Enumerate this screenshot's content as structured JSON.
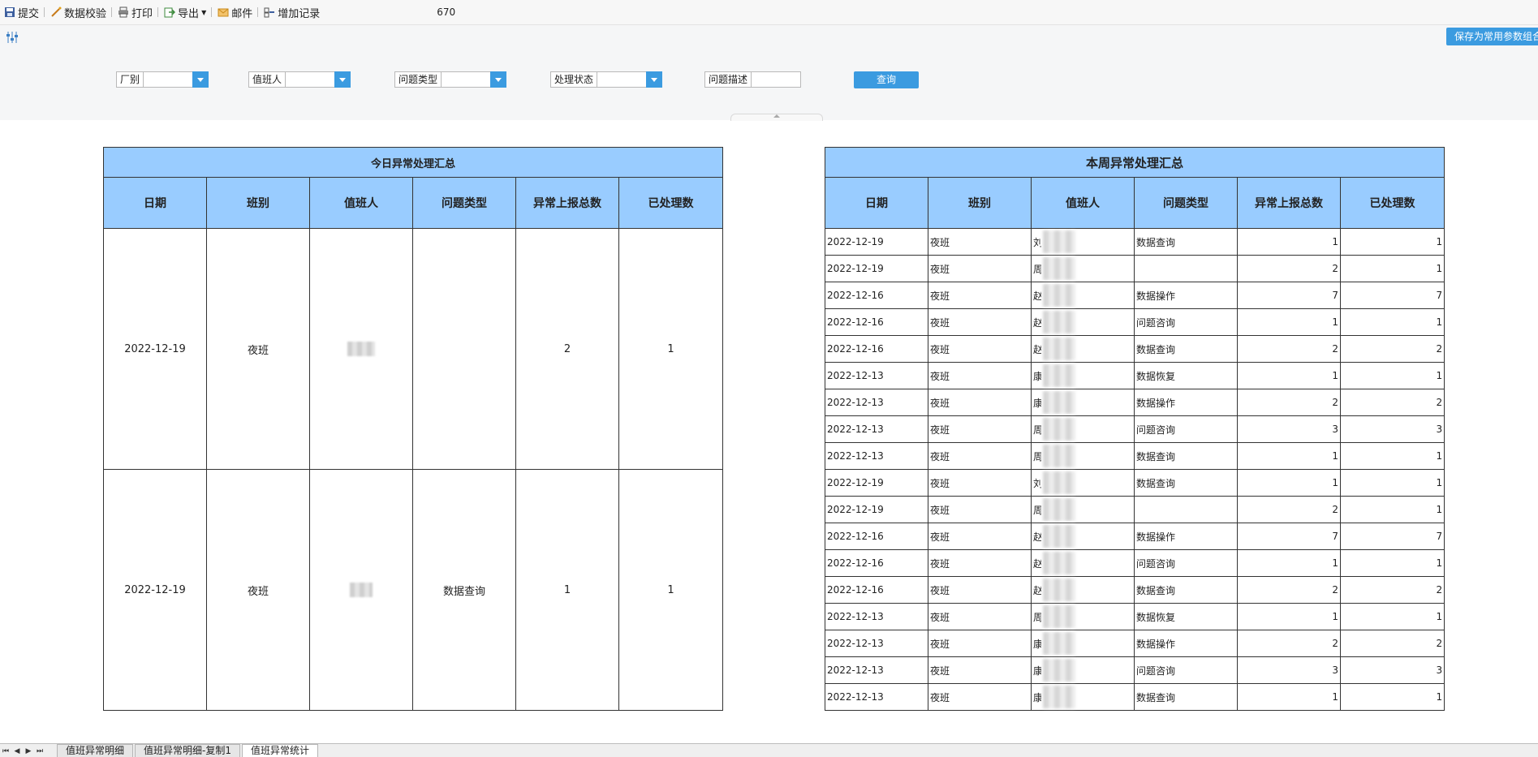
{
  "toolbar": {
    "items": [
      {
        "label": "提交",
        "icon": "save-icon"
      },
      {
        "label": "数据校验",
        "icon": "wand-icon"
      },
      {
        "label": "打印",
        "icon": "print-icon"
      },
      {
        "label": "导出",
        "icon": "export-icon"
      },
      {
        "label": "邮件",
        "icon": "mail-icon"
      },
      {
        "label": "增加记录",
        "icon": "add-record-icon"
      }
    ],
    "number": "670"
  },
  "params": {
    "save_button": "保存为常用参数组合",
    "filters": {
      "factory": "厂别",
      "duty_person": "值班人",
      "issue_type": "问题类型",
      "status": "处理状态",
      "description": "问题描述"
    },
    "query_button": "查询"
  },
  "today": {
    "title": "今日异常处理汇总",
    "headers": [
      "日期",
      "班别",
      "值班人",
      "问题类型",
      "异常上报总数",
      "已处理数"
    ],
    "rows": [
      {
        "date": "2022-12-19",
        "shift": "夜班",
        "type": "",
        "total": "2",
        "handled": "1"
      },
      {
        "date": "2022-12-19",
        "shift": "夜班",
        "type": "数据查询",
        "total": "1",
        "handled": "1"
      }
    ]
  },
  "week": {
    "title": "本周异常处理汇总",
    "headers": [
      "日期",
      "班别",
      "值班人",
      "问题类型",
      "异常上报总数",
      "已处理数"
    ],
    "rows": [
      {
        "date": "2022-12-19",
        "shift": "夜班",
        "person": "刘",
        "type": "数据查询",
        "total": "1",
        "handled": "1"
      },
      {
        "date": "2022-12-19",
        "shift": "夜班",
        "person": "周",
        "type": "",
        "total": "2",
        "handled": "1"
      },
      {
        "date": "2022-12-16",
        "shift": "夜班",
        "person": "赵",
        "type": "数据操作",
        "total": "7",
        "handled": "7"
      },
      {
        "date": "2022-12-16",
        "shift": "夜班",
        "person": "赵",
        "type": "问题咨询",
        "total": "1",
        "handled": "1"
      },
      {
        "date": "2022-12-16",
        "shift": "夜班",
        "person": "赵",
        "type": "数据查询",
        "total": "2",
        "handled": "2"
      },
      {
        "date": "2022-12-13",
        "shift": "夜班",
        "person": "康",
        "type": "数据恢复",
        "total": "1",
        "handled": "1"
      },
      {
        "date": "2022-12-13",
        "shift": "夜班",
        "person": "康",
        "type": "数据操作",
        "total": "2",
        "handled": "2"
      },
      {
        "date": "2022-12-13",
        "shift": "夜班",
        "person": "周",
        "type": "问题咨询",
        "total": "3",
        "handled": "3"
      },
      {
        "date": "2022-12-13",
        "shift": "夜班",
        "person": "周",
        "type": "数据查询",
        "total": "1",
        "handled": "1"
      },
      {
        "date": "2022-12-19",
        "shift": "夜班",
        "person": "刘",
        "type": "数据查询",
        "total": "1",
        "handled": "1"
      },
      {
        "date": "2022-12-19",
        "shift": "夜班",
        "person": "周",
        "type": "",
        "total": "2",
        "handled": "1"
      },
      {
        "date": "2022-12-16",
        "shift": "夜班",
        "person": "赵",
        "type": "数据操作",
        "total": "7",
        "handled": "7"
      },
      {
        "date": "2022-12-16",
        "shift": "夜班",
        "person": "赵",
        "type": "问题咨询",
        "total": "1",
        "handled": "1"
      },
      {
        "date": "2022-12-16",
        "shift": "夜班",
        "person": "赵",
        "type": "数据查询",
        "total": "2",
        "handled": "2"
      },
      {
        "date": "2022-12-13",
        "shift": "夜班",
        "person": "周",
        "type": "数据恢复",
        "total": "1",
        "handled": "1"
      },
      {
        "date": "2022-12-13",
        "shift": "夜班",
        "person": "康",
        "type": "数据操作",
        "total": "2",
        "handled": "2"
      },
      {
        "date": "2022-12-13",
        "shift": "夜班",
        "person": "康",
        "type": "问题咨询",
        "total": "3",
        "handled": "3"
      },
      {
        "date": "2022-12-13",
        "shift": "夜班",
        "person": "康",
        "type": "数据查询",
        "total": "1",
        "handled": "1"
      }
    ]
  },
  "sheets": {
    "nav": [
      "⏮",
      "◀",
      "▶",
      "⏭"
    ],
    "tabs": [
      {
        "label": "值班异常明细",
        "active": false
      },
      {
        "label": "值班异常明细-复制1",
        "active": false
      },
      {
        "label": "值班异常统计",
        "active": true
      }
    ]
  },
  "colors": {
    "accent": "#3b9be0",
    "header_bg": "#99ccff"
  }
}
